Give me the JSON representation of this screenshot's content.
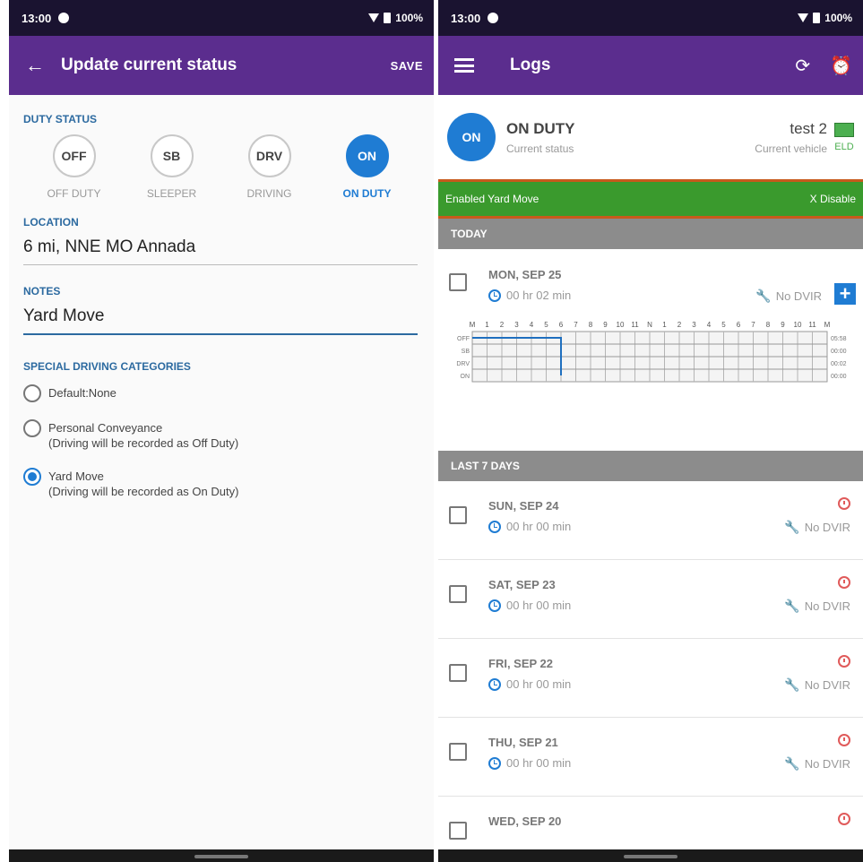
{
  "left": {
    "statusbar": {
      "time": "13:00",
      "battery": "100%"
    },
    "appbar": {
      "title": "Update current status",
      "save_label": "SAVE"
    },
    "duty_status": {
      "label": "DUTY STATUS",
      "options": [
        {
          "code": "OFF",
          "text": "OFF DUTY",
          "selected": false
        },
        {
          "code": "SB",
          "text": "SLEEPER",
          "selected": false
        },
        {
          "code": "DRV",
          "text": "DRIVING",
          "selected": false
        },
        {
          "code": "ON",
          "text": "ON DUTY",
          "selected": true
        }
      ]
    },
    "location": {
      "label": "LOCATION",
      "value": "6 mi, NNE MO Annada"
    },
    "notes": {
      "label": "NOTES",
      "value": "Yard Move"
    },
    "special": {
      "label": "SPECIAL DRIVING CATEGORIES",
      "options": [
        {
          "line1": "Default:None",
          "line2": "",
          "checked": false
        },
        {
          "line1": "Personal Conveyance",
          "line2": "(Driving will be recorded as Off Duty)",
          "checked": false
        },
        {
          "line1": "Yard Move",
          "line2": "(Driving will be recorded as On Duty)",
          "checked": true
        }
      ]
    }
  },
  "right": {
    "statusbar": {
      "time": "13:00",
      "battery": "100%"
    },
    "appbar": {
      "title": "Logs",
      "icons": [
        "sync-icon",
        "alarm-icon"
      ]
    },
    "current": {
      "circle": "ON",
      "status": "ON DUTY",
      "status_label": "Current status",
      "vehicle": "test 2",
      "vehicle_label": "Current vehicle",
      "eld": "ELD"
    },
    "banner": {
      "text": "Enabled Yard Move",
      "action": "X Disable"
    },
    "today_label": "TODAY",
    "today": {
      "date": "MON, SEP 25",
      "time": "00 hr  02 min",
      "dvir": "No DVIR",
      "add": "+",
      "grid": {
        "hour_labels": [
          "M",
          "1",
          "2",
          "3",
          "4",
          "5",
          "6",
          "7",
          "8",
          "9",
          "10",
          "11",
          "N",
          "1",
          "2",
          "3",
          "4",
          "5",
          "6",
          "7",
          "8",
          "9",
          "10",
          "11",
          "M"
        ],
        "rows": [
          "OFF",
          "SB",
          "DRV",
          "ON"
        ],
        "totals": [
          "05:58",
          "00:00",
          "00:02",
          "00:00"
        ],
        "line_color": "#1f6fbf"
      }
    },
    "last7_label": "LAST 7 DAYS",
    "days": [
      {
        "date": "SUN, SEP 24",
        "time": "00 hr  00 min",
        "dvir": "No DVIR"
      },
      {
        "date": "SAT, SEP 23",
        "time": "00 hr  00 min",
        "dvir": "No DVIR"
      },
      {
        "date": "FRI, SEP 22",
        "time": "00 hr  00 min",
        "dvir": "No DVIR"
      },
      {
        "date": "THU, SEP 21",
        "time": "00 hr  00 min",
        "dvir": "No DVIR"
      },
      {
        "date": "WED, SEP 20",
        "time": "",
        "dvir": ""
      }
    ]
  },
  "colors": {
    "appbar": "#5b2d8e",
    "accent": "#1f7cd3",
    "banner": "#3a9a2d",
    "alert": "#e05a5a"
  }
}
